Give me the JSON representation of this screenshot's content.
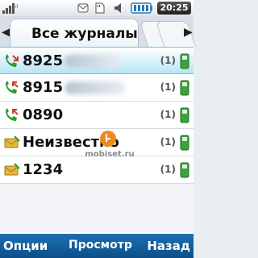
{
  "status": {
    "time": "20:25",
    "icons": [
      "signal-icon",
      "envelope-icon",
      "sd-card-icon",
      "speaker-icon",
      "battery-icon"
    ]
  },
  "header": {
    "title": "Все журналы",
    "left_arrow": "◀",
    "right_arrow": "▶"
  },
  "calls": [
    {
      "number": "8925",
      "type": "incoming-call",
      "count": "(1)",
      "selected": true
    },
    {
      "number": "8915",
      "type": "outgoing-call",
      "count": "(1)",
      "selected": false
    },
    {
      "number": "0890",
      "type": "outgoing-call",
      "count": "(1)",
      "selected": false
    },
    {
      "number": "Неизвестно",
      "type": "message",
      "count": "(1)",
      "selected": false
    },
    {
      "number": "1234",
      "type": "message",
      "count": "(1)",
      "selected": false
    }
  ],
  "watermark": "mobiset.ru",
  "softkeys": {
    "left": "Опции",
    "center": "Просмотр",
    "right": "Назад"
  },
  "colors": {
    "softkey_bg": "#0c4f8a",
    "selection": "#b7e4f6",
    "call_green": "#2e9e2e",
    "missed_red": "#d23b2b",
    "envelope_yellow": "#e6b73a"
  }
}
